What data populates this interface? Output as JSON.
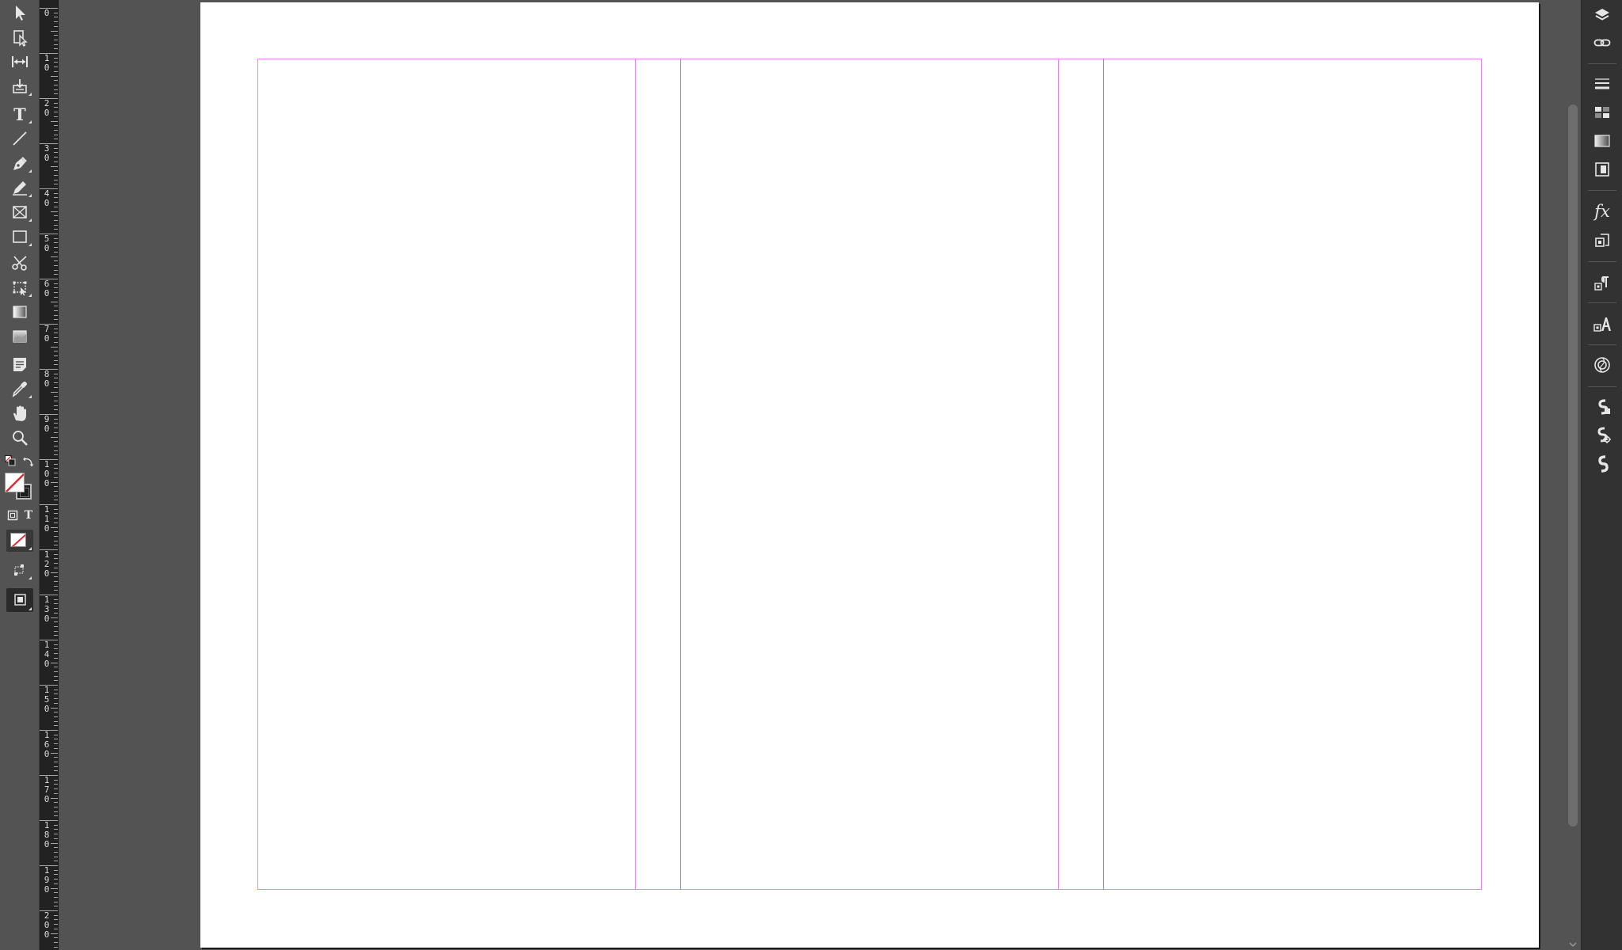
{
  "ruler": {
    "labels": [
      "0",
      "10",
      "20",
      "30",
      "40",
      "50",
      "60",
      "70",
      "80",
      "90",
      "100",
      "110",
      "120",
      "130",
      "140",
      "150",
      "160",
      "170",
      "180",
      "190",
      "200"
    ]
  },
  "toolbar": {
    "tools": [
      "selection-tool-icon",
      "direct-selection-tool-icon",
      "gap-tool-icon",
      "content-collector-icon",
      "type-tool-icon",
      "line-tool-icon",
      "pen-tool-icon",
      "pencil-tool-icon",
      "rectangle-frame-tool-icon",
      "rectangle-tool-icon",
      "scissors-tool-icon",
      "free-transform-tool-icon",
      "gradient-swatch-tool-icon",
      "gradient-feather-tool-icon",
      "note-tool-icon",
      "eyedropper-tool-icon",
      "hand-tool-icon",
      "zoom-tool-icon"
    ],
    "type_glyph": "T",
    "text_format_glyph": "T"
  },
  "dock": {
    "icons": [
      "layers-icon",
      "links-icon",
      "stroke-icon",
      "swatches-icon",
      "gradient-icon",
      "pages-icon",
      "effects-icon",
      "text-wrap-icon",
      "paragraph-styles-icon",
      "character-styles-icon",
      "cc-libraries-icon",
      "scripts-icon",
      "script-label-icon",
      "object-styles-icon"
    ],
    "fx_glyph": "fx"
  },
  "colors": {
    "ui_background": "#535353",
    "ruler_background": "#222222",
    "dock_background": "#323232",
    "page": "#ffffff",
    "margin_guides": "#f07ff0",
    "column_guides": "#c85ee8",
    "none_swatch_slash": "#e0262f"
  }
}
